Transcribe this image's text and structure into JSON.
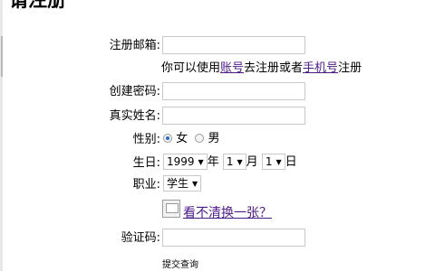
{
  "page": {
    "title": "请注册"
  },
  "form": {
    "email": {
      "label": "注册邮箱:",
      "value": ""
    },
    "hint": {
      "prefix": "你可以使用",
      "link1": "账号",
      "middle": "去注册或者",
      "link2": "手机号",
      "suffix": "注册"
    },
    "password": {
      "label": "创建密码:",
      "value": ""
    },
    "realname": {
      "label": "真实姓名:",
      "value": ""
    },
    "gender": {
      "label": "性别:",
      "female": "女",
      "male": "男",
      "selected": "female"
    },
    "birthday": {
      "label": "生日:",
      "year": "1999",
      "year_unit": "年",
      "month": "1",
      "month_unit": "月",
      "day": "1",
      "day_unit": "日"
    },
    "job": {
      "label": "职业:",
      "value": "学生"
    },
    "captcha": {
      "refresh_link": "看不清换一张？",
      "label": "验证码:",
      "value": ""
    },
    "submit_label": "提交查询"
  }
}
